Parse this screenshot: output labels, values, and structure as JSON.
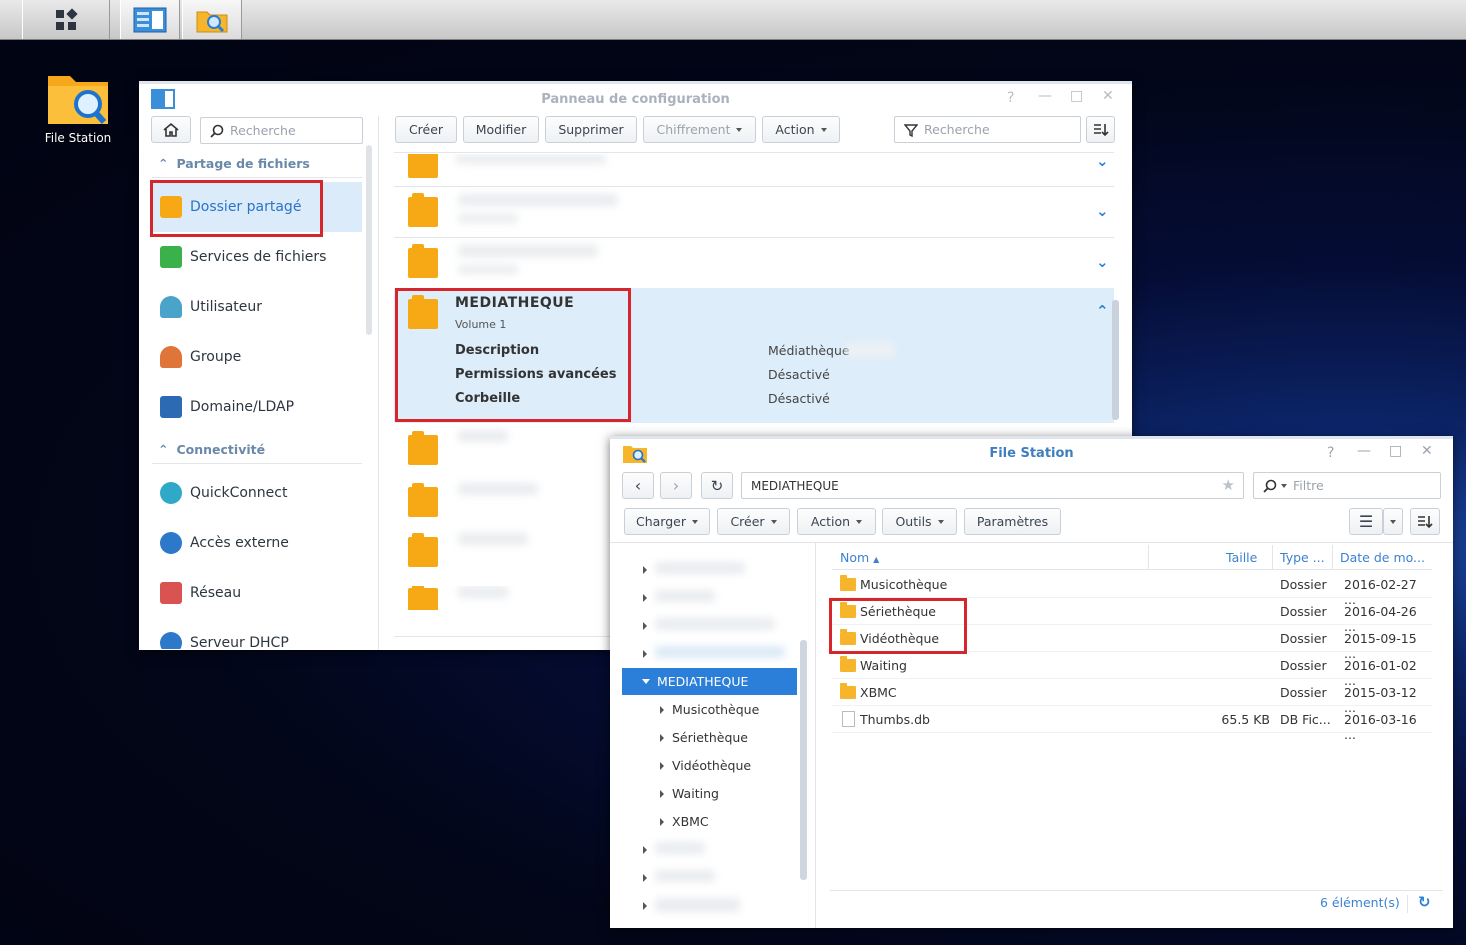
{
  "taskbar": {
    "icons": [
      "main-menu-icon",
      "control-panel-icon",
      "file-station-icon"
    ]
  },
  "desktop": {
    "icon_label": "File Station"
  },
  "control_panel": {
    "title": "Panneau de configuration",
    "search_placeholder": "Recherche",
    "sections": {
      "file_sharing": "Partage de fichiers",
      "connectivity": "Connectivité"
    },
    "nav": [
      "Dossier partagé",
      "Services de fichiers",
      "Utilisateur",
      "Groupe",
      "Domaine/LDAP",
      "QuickConnect",
      "Accès externe",
      "Réseau",
      "Serveur DHCP"
    ],
    "toolbar": {
      "create": "Créer",
      "modify": "Modifier",
      "delete": "Supprimer",
      "encryption": "Chiffrement",
      "action": "Action"
    },
    "filter_placeholder": "Recherche",
    "selected_share": {
      "name": "MEDIATHEQUE",
      "volume": "Volume 1",
      "details": [
        {
          "label": "Description",
          "value": "Médiathèque"
        },
        {
          "label": "Permissions avancées",
          "value": "Désactivé"
        },
        {
          "label": "Corbeille",
          "value": "Désactivé"
        }
      ]
    }
  },
  "file_station": {
    "title": "File Station",
    "path": "MEDIATHEQUE",
    "filter_placeholder": "Filtre",
    "toolbar": {
      "upload": "Charger",
      "create": "Créer",
      "action": "Action",
      "tools": "Outils",
      "settings": "Paramètres"
    },
    "tree": {
      "selected": "MEDIATHEQUE",
      "children": [
        "Musicothèque",
        "Sériethèque",
        "Vidéothèque",
        "Waiting",
        "XBMC"
      ]
    },
    "columns": {
      "name": "Nom",
      "size": "Taille",
      "type": "Type ...",
      "date": "Date de mo..."
    },
    "files": [
      {
        "name": "Musicothèque",
        "size": "",
        "type": "Dossier",
        "date": "2016-02-27 ..."
      },
      {
        "name": "Sériethèque",
        "size": "",
        "type": "Dossier",
        "date": "2016-04-26 ..."
      },
      {
        "name": "Vidéothèque",
        "size": "",
        "type": "Dossier",
        "date": "2015-09-15 ..."
      },
      {
        "name": "Waiting",
        "size": "",
        "type": "Dossier",
        "date": "2016-01-02 ..."
      },
      {
        "name": "XBMC",
        "size": "",
        "type": "Dossier",
        "date": "2015-03-12 ..."
      },
      {
        "name": "Thumbs.db",
        "size": "65.5 KB",
        "type": "DB Fic...",
        "date": "2016-03-16 ..."
      }
    ],
    "item_count": "6 élément(s)"
  }
}
